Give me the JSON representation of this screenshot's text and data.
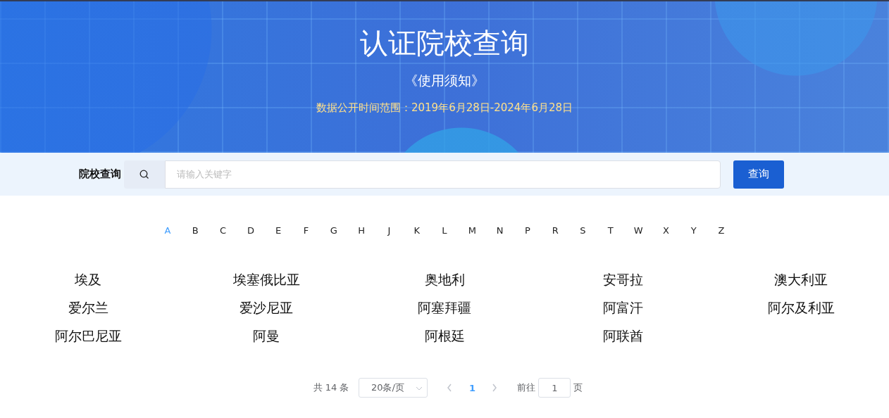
{
  "header": {
    "title": "认证院校查询",
    "notice_link": "《使用须知》",
    "date_range": "数据公开时间范围：2019年6月28日-2024年6月28日"
  },
  "search": {
    "label": "院校查询",
    "placeholder": "请输入关键字",
    "button": "查询"
  },
  "letters": [
    {
      "label": "A",
      "selected": true
    },
    {
      "label": "B",
      "selected": false
    },
    {
      "label": "C",
      "selected": false
    },
    {
      "label": "D",
      "selected": false
    },
    {
      "label": "E",
      "selected": false
    },
    {
      "label": "F",
      "selected": false
    },
    {
      "label": "G",
      "selected": false
    },
    {
      "label": "H",
      "selected": false
    },
    {
      "label": "J",
      "selected": false
    },
    {
      "label": "K",
      "selected": false
    },
    {
      "label": "L",
      "selected": false
    },
    {
      "label": "M",
      "selected": false
    },
    {
      "label": "N",
      "selected": false
    },
    {
      "label": "P",
      "selected": false
    },
    {
      "label": "R",
      "selected": false
    },
    {
      "label": "S",
      "selected": false
    },
    {
      "label": "T",
      "selected": false
    },
    {
      "label": "W",
      "selected": false
    },
    {
      "label": "X",
      "selected": false
    },
    {
      "label": "Y",
      "selected": false
    },
    {
      "label": "Z",
      "selected": false
    }
  ],
  "countries": [
    "埃及",
    "埃塞俄比亚",
    "奥地利",
    "安哥拉",
    "澳大利亚",
    "爱尔兰",
    "爱沙尼亚",
    "阿塞拜疆",
    "阿富汗",
    "阿尔及利亚",
    "阿尔巴尼亚",
    "阿曼",
    "阿根廷",
    "阿联酋"
  ],
  "pagination": {
    "total": "共 14 条",
    "page_size": "20条/页",
    "pages": [
      {
        "label": "1",
        "selected": true
      }
    ],
    "goto_label": "前往",
    "goto_value": "1",
    "goto_suffix": "页"
  }
}
